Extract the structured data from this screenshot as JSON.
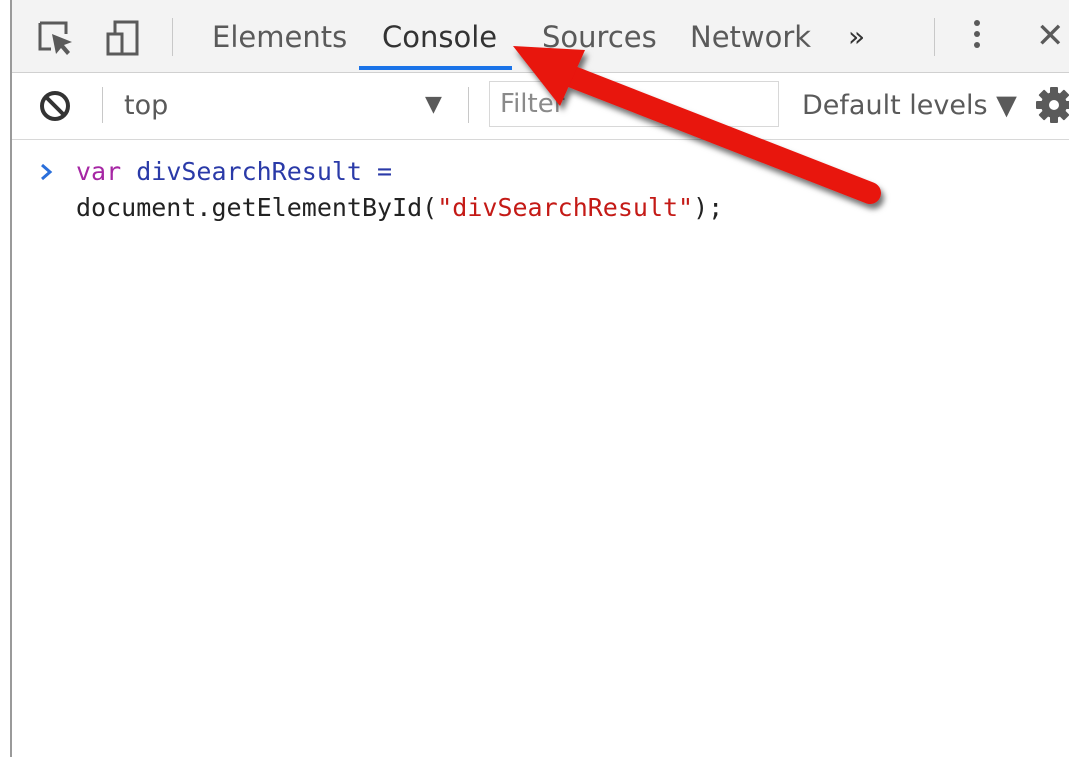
{
  "tabs": {
    "items": [
      {
        "label": "Elements"
      },
      {
        "label": "Console",
        "active": true
      },
      {
        "label": "Sources"
      },
      {
        "label": "Network"
      }
    ],
    "more_label": "»",
    "close_label": "✕"
  },
  "toolbar": {
    "context": "top",
    "context_caret": "▼",
    "filter_placeholder": "Filter",
    "levels_label": "Default levels ▼"
  },
  "console": {
    "line1_keyword": "var",
    "line1_ident": "divSearchResult",
    "line1_op": " =",
    "line2_pre": "document.getElementById(",
    "line2_string": "\"divSearchResult\"",
    "line2_post": ");"
  },
  "icons": {
    "inspect": "inspect-element-icon",
    "device": "device-toolbar-icon",
    "clear": "clear-console-icon",
    "settings": "gear-icon",
    "prompt": "chevron-right-icon",
    "annotation": "red-arrow-annotation"
  },
  "colors": {
    "active_tab_underline": "#1a73e8",
    "annotation_arrow": "#e8120c",
    "keyword": "#a626a4",
    "identifier": "#2a3aa8",
    "string": "#c41a16"
  }
}
